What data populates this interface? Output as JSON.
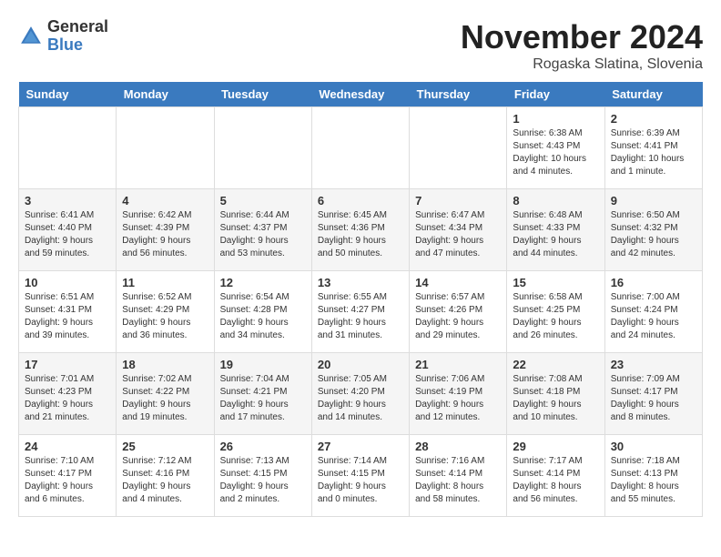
{
  "logo": {
    "general": "General",
    "blue": "Blue"
  },
  "title": "November 2024",
  "location": "Rogaska Slatina, Slovenia",
  "weekdays": [
    "Sunday",
    "Monday",
    "Tuesday",
    "Wednesday",
    "Thursday",
    "Friday",
    "Saturday"
  ],
  "weeks": [
    [
      {
        "day": "",
        "info": ""
      },
      {
        "day": "",
        "info": ""
      },
      {
        "day": "",
        "info": ""
      },
      {
        "day": "",
        "info": ""
      },
      {
        "day": "",
        "info": ""
      },
      {
        "day": "1",
        "info": "Sunrise: 6:38 AM\nSunset: 4:43 PM\nDaylight: 10 hours\nand 4 minutes."
      },
      {
        "day": "2",
        "info": "Sunrise: 6:39 AM\nSunset: 4:41 PM\nDaylight: 10 hours\nand 1 minute."
      }
    ],
    [
      {
        "day": "3",
        "info": "Sunrise: 6:41 AM\nSunset: 4:40 PM\nDaylight: 9 hours\nand 59 minutes."
      },
      {
        "day": "4",
        "info": "Sunrise: 6:42 AM\nSunset: 4:39 PM\nDaylight: 9 hours\nand 56 minutes."
      },
      {
        "day": "5",
        "info": "Sunrise: 6:44 AM\nSunset: 4:37 PM\nDaylight: 9 hours\nand 53 minutes."
      },
      {
        "day": "6",
        "info": "Sunrise: 6:45 AM\nSunset: 4:36 PM\nDaylight: 9 hours\nand 50 minutes."
      },
      {
        "day": "7",
        "info": "Sunrise: 6:47 AM\nSunset: 4:34 PM\nDaylight: 9 hours\nand 47 minutes."
      },
      {
        "day": "8",
        "info": "Sunrise: 6:48 AM\nSunset: 4:33 PM\nDaylight: 9 hours\nand 44 minutes."
      },
      {
        "day": "9",
        "info": "Sunrise: 6:50 AM\nSunset: 4:32 PM\nDaylight: 9 hours\nand 42 minutes."
      }
    ],
    [
      {
        "day": "10",
        "info": "Sunrise: 6:51 AM\nSunset: 4:31 PM\nDaylight: 9 hours\nand 39 minutes."
      },
      {
        "day": "11",
        "info": "Sunrise: 6:52 AM\nSunset: 4:29 PM\nDaylight: 9 hours\nand 36 minutes."
      },
      {
        "day": "12",
        "info": "Sunrise: 6:54 AM\nSunset: 4:28 PM\nDaylight: 9 hours\nand 34 minutes."
      },
      {
        "day": "13",
        "info": "Sunrise: 6:55 AM\nSunset: 4:27 PM\nDaylight: 9 hours\nand 31 minutes."
      },
      {
        "day": "14",
        "info": "Sunrise: 6:57 AM\nSunset: 4:26 PM\nDaylight: 9 hours\nand 29 minutes."
      },
      {
        "day": "15",
        "info": "Sunrise: 6:58 AM\nSunset: 4:25 PM\nDaylight: 9 hours\nand 26 minutes."
      },
      {
        "day": "16",
        "info": "Sunrise: 7:00 AM\nSunset: 4:24 PM\nDaylight: 9 hours\nand 24 minutes."
      }
    ],
    [
      {
        "day": "17",
        "info": "Sunrise: 7:01 AM\nSunset: 4:23 PM\nDaylight: 9 hours\nand 21 minutes."
      },
      {
        "day": "18",
        "info": "Sunrise: 7:02 AM\nSunset: 4:22 PM\nDaylight: 9 hours\nand 19 minutes."
      },
      {
        "day": "19",
        "info": "Sunrise: 7:04 AM\nSunset: 4:21 PM\nDaylight: 9 hours\nand 17 minutes."
      },
      {
        "day": "20",
        "info": "Sunrise: 7:05 AM\nSunset: 4:20 PM\nDaylight: 9 hours\nand 14 minutes."
      },
      {
        "day": "21",
        "info": "Sunrise: 7:06 AM\nSunset: 4:19 PM\nDaylight: 9 hours\nand 12 minutes."
      },
      {
        "day": "22",
        "info": "Sunrise: 7:08 AM\nSunset: 4:18 PM\nDaylight: 9 hours\nand 10 minutes."
      },
      {
        "day": "23",
        "info": "Sunrise: 7:09 AM\nSunset: 4:17 PM\nDaylight: 9 hours\nand 8 minutes."
      }
    ],
    [
      {
        "day": "24",
        "info": "Sunrise: 7:10 AM\nSunset: 4:17 PM\nDaylight: 9 hours\nand 6 minutes."
      },
      {
        "day": "25",
        "info": "Sunrise: 7:12 AM\nSunset: 4:16 PM\nDaylight: 9 hours\nand 4 minutes."
      },
      {
        "day": "26",
        "info": "Sunrise: 7:13 AM\nSunset: 4:15 PM\nDaylight: 9 hours\nand 2 minutes."
      },
      {
        "day": "27",
        "info": "Sunrise: 7:14 AM\nSunset: 4:15 PM\nDaylight: 9 hours\nand 0 minutes."
      },
      {
        "day": "28",
        "info": "Sunrise: 7:16 AM\nSunset: 4:14 PM\nDaylight: 8 hours\nand 58 minutes."
      },
      {
        "day": "29",
        "info": "Sunrise: 7:17 AM\nSunset: 4:14 PM\nDaylight: 8 hours\nand 56 minutes."
      },
      {
        "day": "30",
        "info": "Sunrise: 7:18 AM\nSunset: 4:13 PM\nDaylight: 8 hours\nand 55 minutes."
      }
    ]
  ]
}
